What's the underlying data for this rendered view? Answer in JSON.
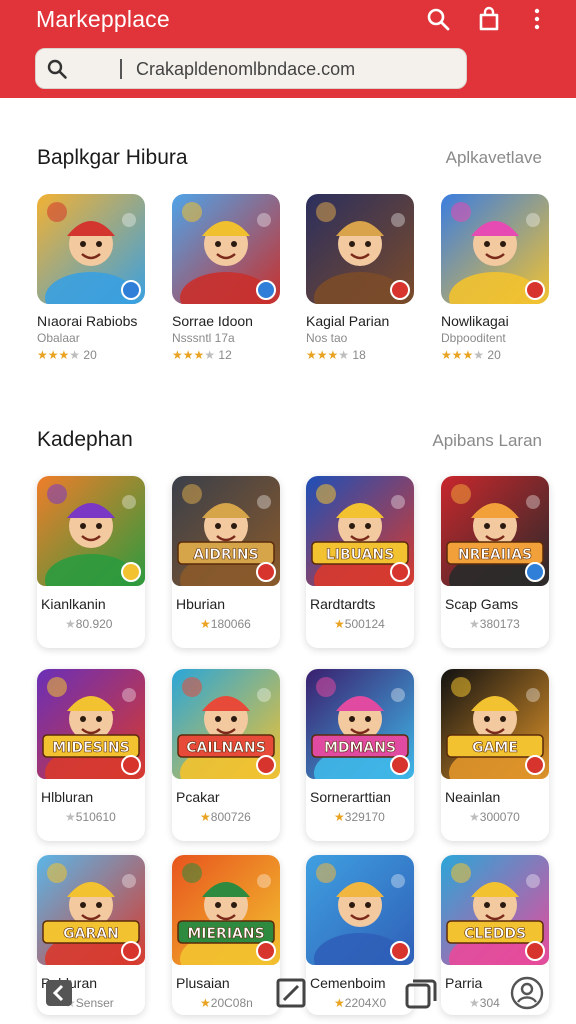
{
  "header": {
    "title": "Markepplace",
    "search_value": "Crakapldenomlbndace.com",
    "icons": [
      "search-icon",
      "bag-icon",
      "more-vert-icon"
    ]
  },
  "section1": {
    "title": "Baplkgar Hibura",
    "link": "Aplkavetlave",
    "apps": [
      {
        "name": "Nıaorai Rabiobs",
        "sub": "Obalaar",
        "rating": "20",
        "stars": 3,
        "colors": [
          "#f2b134",
          "#d2362e",
          "#3aa0e0"
        ]
      },
      {
        "name": "Sorrae Idoon",
        "sub": "Nsssntl 17a",
        "rating": "12",
        "stars": 3,
        "colors": [
          "#4fa3e8",
          "#f0c02f",
          "#c9302c"
        ]
      },
      {
        "name": "Kagial Parian",
        "sub": "Nos tao",
        "rating": "18",
        "stars": 3,
        "colors": [
          "#2b2f5e",
          "#d8a34b",
          "#7b4b2a"
        ]
      },
      {
        "name": "Nowlikagai",
        "sub": "Dbpooditent",
        "rating": "20",
        "stars": 3,
        "colors": [
          "#3b7de0",
          "#e54bb2",
          "#f2c230"
        ]
      }
    ]
  },
  "section2": {
    "title": "Kadephan",
    "link": "Apibans Laran",
    "apps": [
      {
        "name": "Kianlkanin",
        "rating": "80.920",
        "label": "",
        "colors": [
          "#f07d2a",
          "#7a38c4",
          "#2c9a3e"
        ]
      },
      {
        "name": "Hburian",
        "rating": "180066",
        "label": "AIDRINS",
        "colors": [
          "#3a3f4a",
          "#d6a54a",
          "#8a5a2b"
        ]
      },
      {
        "name": "Rardtardts",
        "rating": "500124",
        "label": "LIBUANS",
        "colors": [
          "#1d4fb8",
          "#f2c230",
          "#d83a2d"
        ]
      },
      {
        "name": "Scap Gams",
        "rating": "380173",
        "label": "NREAIIAS",
        "colors": [
          "#c8272d",
          "#f2a13a",
          "#2a2a2a"
        ]
      },
      {
        "name": "Hlbluran",
        "rating": "510610",
        "label": "MIDESINS",
        "colors": [
          "#6a2fb8",
          "#f2c230",
          "#d83a2d"
        ]
      },
      {
        "name": "Pcakar",
        "rating": "800726",
        "label": "CAILNANS",
        "colors": [
          "#2aa6d8",
          "#e84a3a",
          "#f2c230"
        ]
      },
      {
        "name": "Sornerarttian",
        "rating": "329170",
        "label": "MDMANS",
        "colors": [
          "#3a1f6e",
          "#e04aa0",
          "#3fb7e8"
        ]
      },
      {
        "name": "Neainlan",
        "rating": "300070",
        "label": "GAME",
        "colors": [
          "#111111",
          "#f2c230",
          "#e0952a"
        ]
      },
      {
        "name": "Pahluran",
        "rating": "Senser",
        "label": "GARAN",
        "colors": [
          "#5ab6e8",
          "#f2c230",
          "#d83a2d"
        ]
      },
      {
        "name": "Plusaian",
        "rating": "20C08n",
        "label": "MIERIANS",
        "colors": [
          "#e8541e",
          "#2e8a3e",
          "#f2c230"
        ]
      },
      {
        "name": "Cemenboim",
        "rating": "2204X0",
        "label": "",
        "colors": [
          "#3fa0e0",
          "#f0b640",
          "#2f5fb8"
        ]
      },
      {
        "name": "Parria",
        "rating": "304",
        "label": "CLEDDS",
        "colors": [
          "#2aa6d8",
          "#f2c230",
          "#e84a9a"
        ]
      }
    ]
  },
  "navbar": {
    "icons": [
      "back-icon",
      "edit-square-icon",
      "recents-icon",
      "account-icon"
    ]
  }
}
